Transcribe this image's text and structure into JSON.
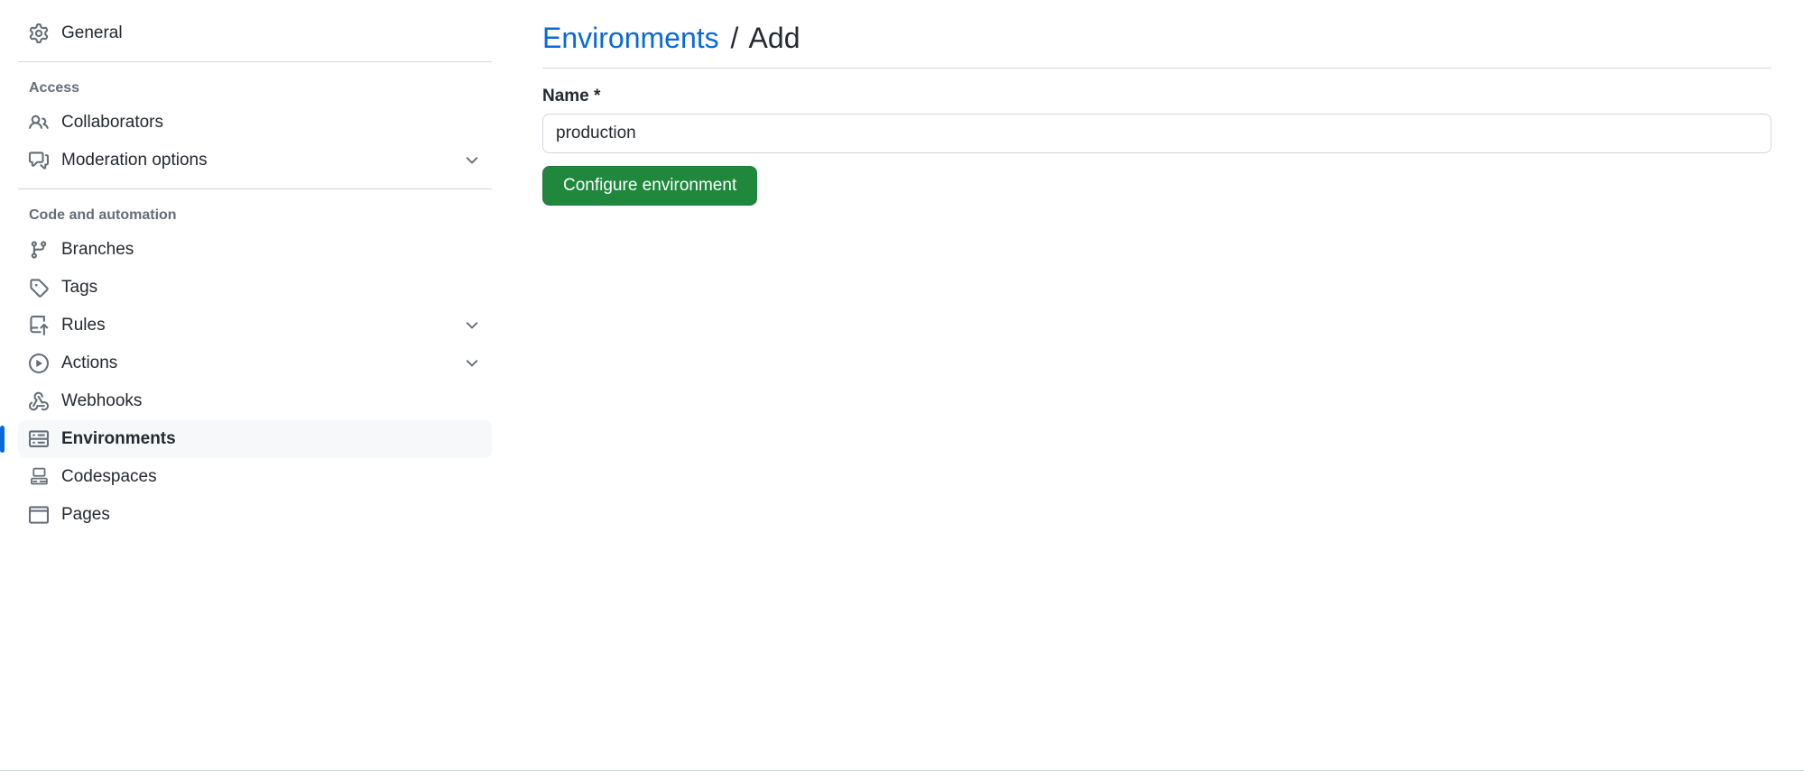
{
  "sidebar": {
    "general_label": "General",
    "section_access": "Access",
    "section_code": "Code and automation",
    "collaborators_label": "Collaborators",
    "moderation_label": "Moderation options",
    "branches_label": "Branches",
    "tags_label": "Tags",
    "rules_label": "Rules",
    "actions_label": "Actions",
    "webhooks_label": "Webhooks",
    "environments_label": "Environments",
    "codespaces_label": "Codespaces",
    "pages_label": "Pages"
  },
  "breadcrumb": {
    "parent": "Environments",
    "separator": "/",
    "current": "Add"
  },
  "form": {
    "name_label": "Name *",
    "name_value": "production",
    "submit_label": "Configure environment"
  }
}
